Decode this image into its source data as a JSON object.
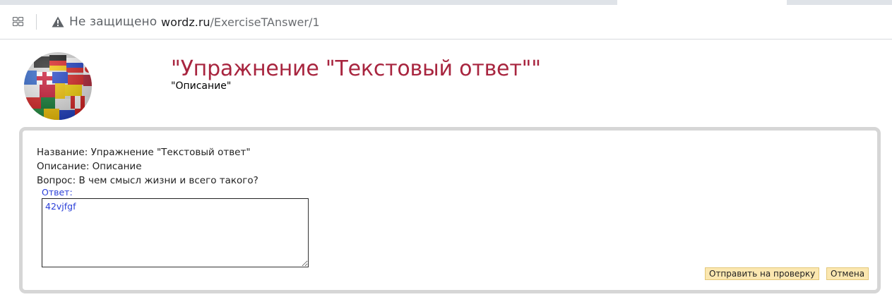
{
  "browser": {
    "security_label": "Не защищено",
    "url_domain": "wordz.ru",
    "url_path": "/ExerciseTAnswer/1",
    "icons": [
      "apps-icon",
      "warning-icon"
    ]
  },
  "header": {
    "title": "\"Упражнение \"Текстовый ответ\"\"",
    "subtitle": "\"Описание\"",
    "logo_icon": "flags-globe-logo"
  },
  "exercise": {
    "name_line": "Название: Упражнение \"Текстовый ответ\"",
    "description_line": "Описание: Описание",
    "question_line": "Вопрос: В чем смысл жизни и всего такого?",
    "answer_label": "Ответ:",
    "answer_value": "42vjfgf"
  },
  "actions": {
    "submit_label": "Отправить на проверку",
    "cancel_label": "Отмена"
  },
  "colors": {
    "title": "#a8253f",
    "answer_text": "#2a3fd8",
    "button_bg": "#fbe7b0",
    "panel_border": "#d6d6d6"
  }
}
